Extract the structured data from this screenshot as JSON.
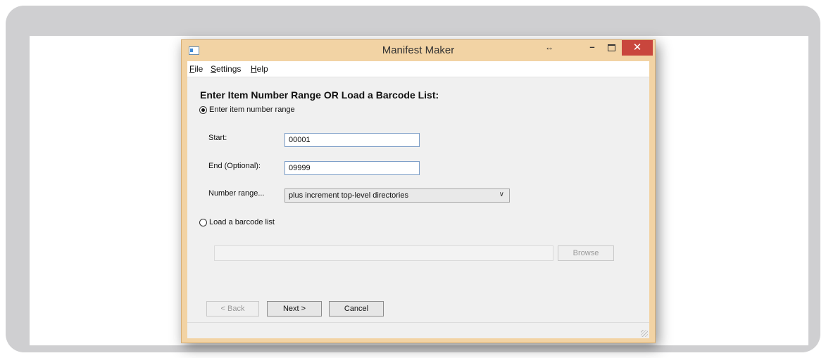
{
  "window": {
    "title": "Manifest Maker",
    "restore_glyph": "↔",
    "min_glyph": "–",
    "close_glyph": "✕"
  },
  "menu": {
    "file": {
      "accel": "F",
      "rest": "ile"
    },
    "settings": {
      "accel": "S",
      "rest": "ettings"
    },
    "help": {
      "accel": "H",
      "rest": "elp"
    }
  },
  "form": {
    "heading": "Enter Item Number Range OR Load a Barcode List:",
    "range_radio_label": "Enter item number range",
    "range_radio_checked": true,
    "start_label": "Start:",
    "start_value": "00001",
    "end_label": "End (Optional):",
    "end_value": "09999",
    "number_range_label": "Number range...",
    "number_range_selected": "plus increment top-level directories",
    "barcode_radio_label": "Load a barcode list",
    "barcode_radio_checked": false,
    "barcode_path_value": "",
    "browse_label": "Browse"
  },
  "buttons": {
    "back": "< Back",
    "next": "Next >",
    "cancel": "Cancel"
  },
  "colors": {
    "close_button": "#c9463d",
    "window_border": "#f2d3a4",
    "input_border": "#7a9cc6"
  }
}
